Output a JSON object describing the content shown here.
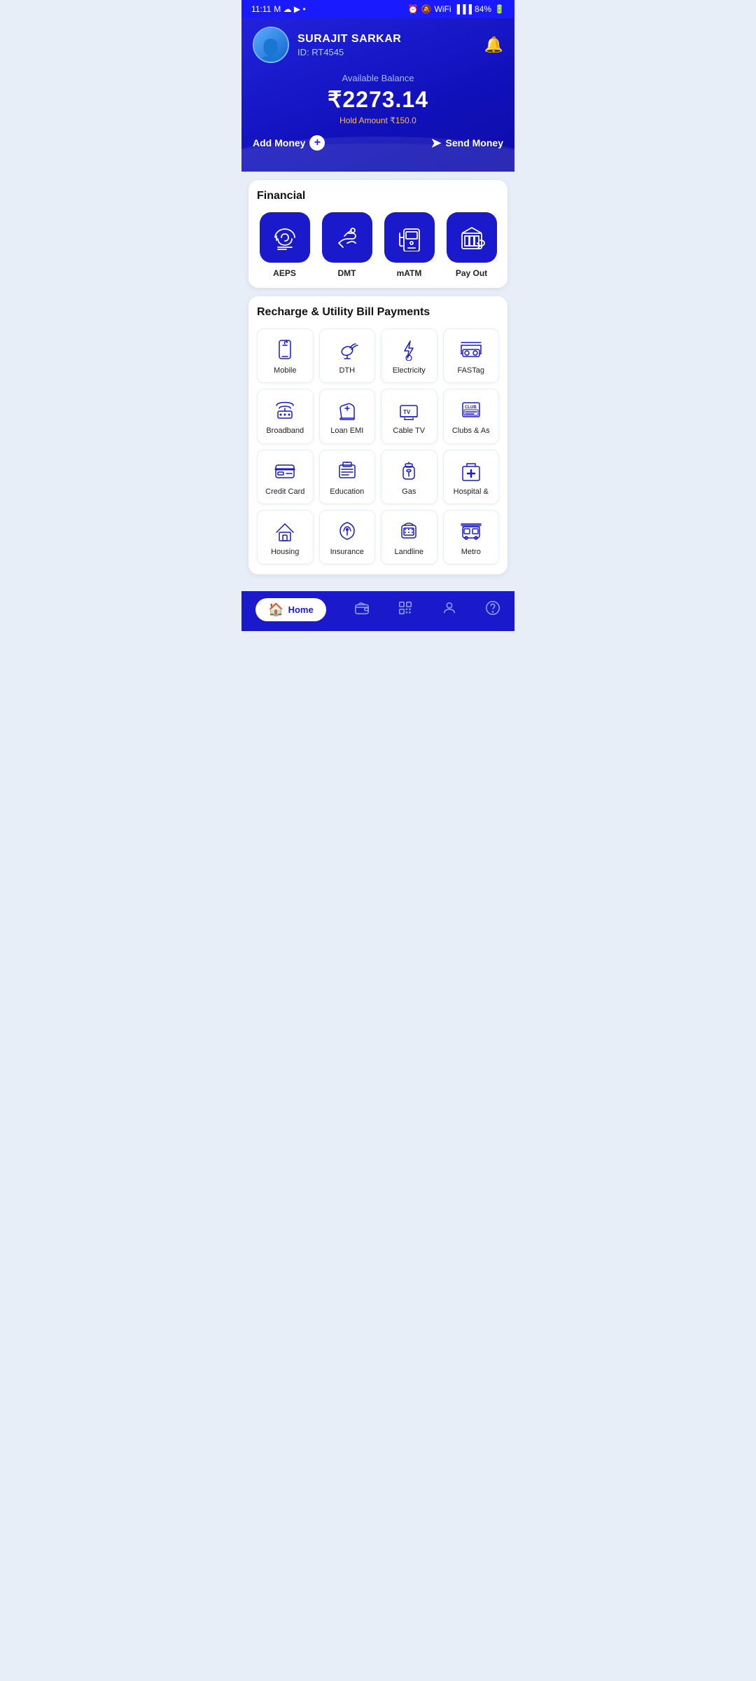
{
  "statusBar": {
    "time": "11:11",
    "battery": "84%"
  },
  "header": {
    "userName": "SURAJIT SARKAR",
    "userId": "ID: RT4545",
    "balanceLabel": "Available Balance",
    "balanceAmount": "₹2273.14",
    "holdAmount": "Hold Amount ₹150.0",
    "addMoneyLabel": "Add Money",
    "sendMoneyLabel": "Send Money"
  },
  "financial": {
    "title": "Financial",
    "items": [
      {
        "id": "aeps",
        "label": "AEPS"
      },
      {
        "id": "dmt",
        "label": "DMT"
      },
      {
        "id": "matm",
        "label": "mATM"
      },
      {
        "id": "payout",
        "label": "Pay Out"
      }
    ]
  },
  "utility": {
    "title": "Recharge & Utility Bill Payments",
    "items": [
      {
        "id": "mobile",
        "label": "Mobile"
      },
      {
        "id": "dth",
        "label": "DTH"
      },
      {
        "id": "electricity",
        "label": "Electricity"
      },
      {
        "id": "fastag",
        "label": "FASTag"
      },
      {
        "id": "broadband",
        "label": "Broadband"
      },
      {
        "id": "loanemi",
        "label": "Loan EMI"
      },
      {
        "id": "cabletv",
        "label": "Cable TV"
      },
      {
        "id": "clubs",
        "label": "Clubs & As"
      },
      {
        "id": "creditcard",
        "label": "Credit Card"
      },
      {
        "id": "education",
        "label": "Education"
      },
      {
        "id": "gas",
        "label": "Gas"
      },
      {
        "id": "hospital",
        "label": "Hospital &"
      },
      {
        "id": "housing",
        "label": "Housing"
      },
      {
        "id": "insurance",
        "label": "Insurance"
      },
      {
        "id": "landline",
        "label": "Landline"
      },
      {
        "id": "metro",
        "label": "Metro"
      }
    ]
  },
  "bottomNav": {
    "items": [
      {
        "id": "home",
        "label": "Home",
        "active": true
      },
      {
        "id": "wallet",
        "label": "Wallet",
        "active": false
      },
      {
        "id": "scan",
        "label": "Scan",
        "active": false
      },
      {
        "id": "profile",
        "label": "Profile",
        "active": false
      },
      {
        "id": "help",
        "label": "Help",
        "active": false
      }
    ]
  }
}
